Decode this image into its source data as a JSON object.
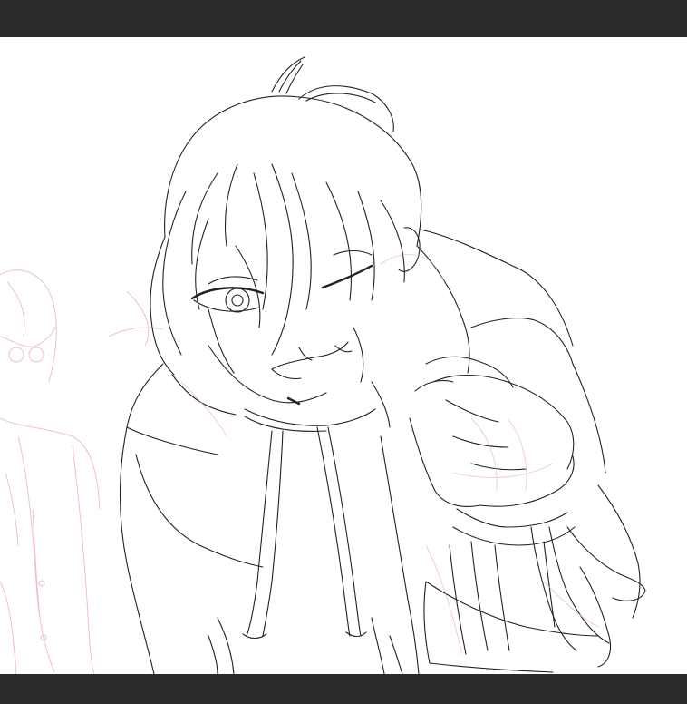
{
  "colors": {
    "frame": "#2b2b2b",
    "canvas": "#ffffff",
    "lineart": "#1a1a1a",
    "sketch": "#e8a6b4"
  },
  "canvas": {
    "content": "lineart-drawing-winking-character-in-hoodie"
  }
}
